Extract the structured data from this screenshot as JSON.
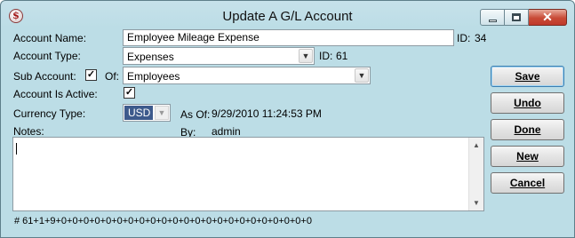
{
  "window": {
    "title": "Update A G/L Account",
    "app_icon_glyph": "$",
    "close_glyph": "✕"
  },
  "form": {
    "account_name_label": "Account Name:",
    "account_name_value": "Employee Mileage Expense",
    "id_label": "ID:",
    "id_value": "34",
    "account_type_label": "Account Type:",
    "account_type_value": "Expenses",
    "type_id_label": "ID:",
    "type_id_value": "61",
    "sub_account_label": "Sub Account:",
    "sub_account_checked": true,
    "of_label": "Of:",
    "of_value": "Employees",
    "account_active_label": "Account Is Active:",
    "account_active_checked": true,
    "currency_label": "Currency Type:",
    "currency_value": "USD",
    "as_of_label": "As Of:",
    "as_of_value": "9/29/2010 11:24:53 PM",
    "notes_label": "Notes:",
    "by_label": "By:",
    "by_value": "admin",
    "notes_value": "",
    "footer_code": "# 61+1+9+0+0+0+0+0+0+0+0+0+0+0+0+0+0+0+0+0+0+0+0+0+0+0"
  },
  "buttons": {
    "save": "Save",
    "undo": "Undo",
    "done": "Done",
    "new": "New",
    "cancel": "Cancel"
  },
  "icons": {
    "check_glyph": "✓",
    "dropdown_glyph": "▼",
    "scroll_up_glyph": "▲",
    "scroll_down_glyph": "▼"
  }
}
